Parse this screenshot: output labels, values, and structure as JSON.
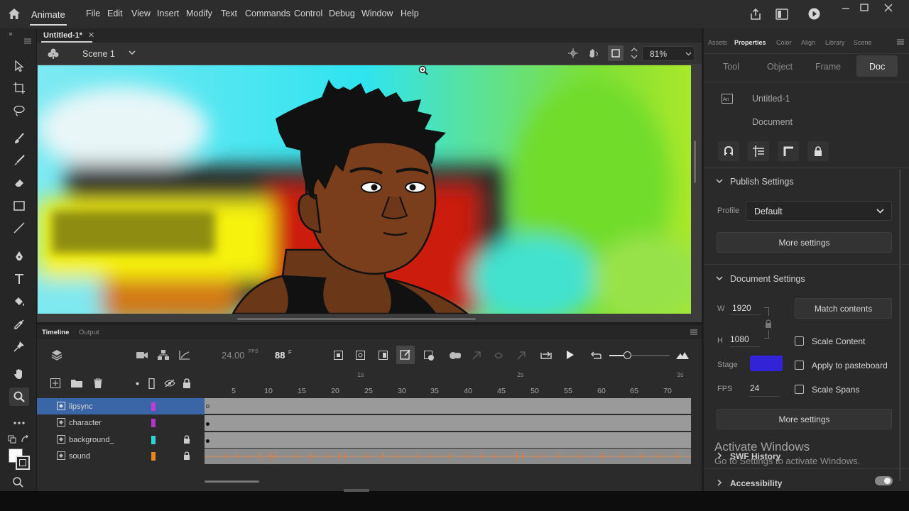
{
  "app": {
    "name": "Animate"
  },
  "menu": [
    "File",
    "Edit",
    "View",
    "Insert",
    "Modify",
    "Text",
    "Commands",
    "Control",
    "Debug",
    "Window",
    "Help"
  ],
  "document": {
    "tab_title": "Untitled-1*",
    "scene": "Scene 1",
    "zoom": "81%"
  },
  "timeline": {
    "tabs": [
      "Timeline",
      "Output"
    ],
    "fps": "24.00",
    "fps_unit": "FPS",
    "frame": "88",
    "frame_unit": "F",
    "ruler_seconds": [
      "1s",
      "2s",
      "3s"
    ],
    "ruler_frames": [
      "5",
      "10",
      "15",
      "20",
      "25",
      "30",
      "35",
      "40",
      "45",
      "50",
      "55",
      "60",
      "65",
      "70"
    ],
    "layers": [
      {
        "name": "lipsync",
        "color": "#c23cd6",
        "locked": false,
        "selected": true
      },
      {
        "name": "character",
        "color": "#b433c9",
        "locked": false,
        "selected": false
      },
      {
        "name": "background_",
        "color": "#2fd3d3",
        "locked": true,
        "selected": false
      },
      {
        "name": "sound",
        "color": "#e8861d",
        "locked": true,
        "selected": false
      }
    ]
  },
  "properties": {
    "panel_tabs": [
      "Assets",
      "Properties",
      "Color",
      "Align",
      "Library",
      "Scene"
    ],
    "active_panel_tab": "Properties",
    "subtabs": [
      "Tool",
      "Object",
      "Frame",
      "Doc"
    ],
    "active_subtab": "Doc",
    "doc_name": "Untitled-1",
    "doc_type": "Document",
    "publish": {
      "title": "Publish Settings",
      "profile_label": "Profile",
      "profile_value": "Default",
      "more_settings": "More settings"
    },
    "docsettings": {
      "title": "Document Settings",
      "w_label": "W",
      "w_value": "1920",
      "h_label": "H",
      "h_value": "1080",
      "match_contents": "Match contents",
      "scale_content": "Scale Content",
      "apply_pasteboard": "Apply to pasteboard",
      "scale_spans": "Scale Spans",
      "stage_label": "Stage",
      "stage_color": "#3223d6",
      "fps_label": "FPS",
      "fps_value": "24",
      "more_settings": "More settings"
    },
    "swf_history": "SWF History",
    "accessibility": "Accessibility"
  },
  "watermark": {
    "line1": "Activate Windows",
    "line2": "Go to Settings to activate Windows."
  }
}
